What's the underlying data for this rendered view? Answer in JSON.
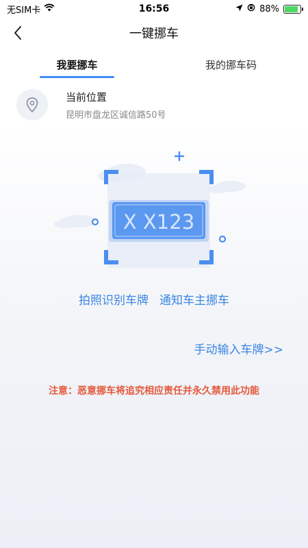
{
  "status_bar": {
    "carrier": "无SIM卡",
    "time": "16:56",
    "battery_percent": "88%",
    "battery_level": 0.88
  },
  "nav": {
    "title": "一键挪车"
  },
  "tabs": [
    {
      "label": "我要挪车",
      "active": true
    },
    {
      "label": "我的挪车码",
      "active": false
    }
  ],
  "location": {
    "title": "当前位置",
    "address": "昆明市盘龙区诚信路50号"
  },
  "scan": {
    "plate_text": "X X123"
  },
  "actions": {
    "photo_recognize": "拍照识别车牌",
    "notify_owner": "通知车主挪车"
  },
  "manual_input": "手动输入车牌>>",
  "notice": "注意：恶意挪车将追究相应责任并永久禁用此功能",
  "colors": {
    "accent": "#3b86e3",
    "warning": "#e4583b"
  }
}
